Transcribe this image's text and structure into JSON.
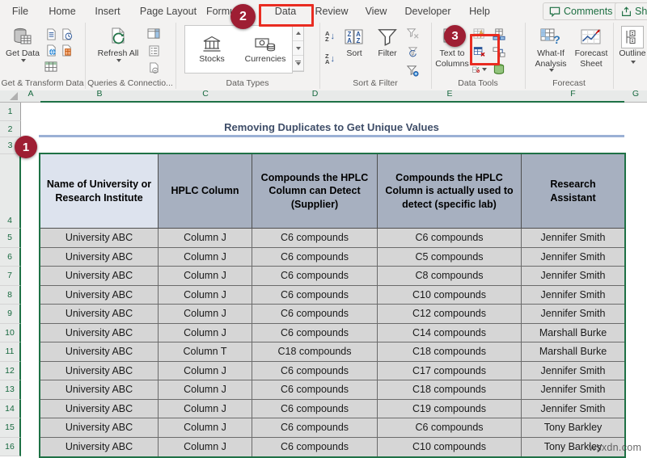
{
  "annotations": {
    "badge1": "1",
    "badge2": "2",
    "badge3": "3"
  },
  "ribbon": {
    "tabs": [
      "File",
      "Home",
      "Insert",
      "Page Layout",
      "Formulas",
      "Data",
      "Review",
      "View",
      "Developer",
      "Help"
    ],
    "comments_label": "Comments",
    "share_label": "Share",
    "groups": {
      "get_transform": {
        "label": "Get & Transform Data",
        "get_data": "Get Data"
      },
      "queries": {
        "label": "Queries & Connectio...",
        "refresh_all": "Refresh All"
      },
      "data_types": {
        "label": "Data Types",
        "stocks": "Stocks",
        "currencies": "Currencies"
      },
      "sort_filter": {
        "label": "Sort & Filter",
        "sort": "Sort",
        "filter": "Filter"
      },
      "data_tools": {
        "label": "Data Tools",
        "text_to_columns": "Text to Columns"
      },
      "forecast": {
        "label": "Forecast",
        "what_if": "What-If Analysis",
        "forecast_sheet": "Forecast Sheet"
      },
      "outline": {
        "outline": "Outline"
      }
    }
  },
  "sheet": {
    "column_letters": [
      "A",
      "B",
      "C",
      "D",
      "E",
      "F",
      "G"
    ],
    "row_numbers_top": [
      "1",
      "2",
      "3",
      "4"
    ],
    "title": "Removing Duplicates to Get Unique Values",
    "watermark": "wsxdn.com"
  },
  "table": {
    "headers": [
      "Name of University or Research Institute",
      "HPLC Column",
      "Compounds the HPLC Column can Detect (Supplier)",
      "Compounds the HPLC Column is actually used to detect (specific lab)",
      "Research Assistant"
    ],
    "rows": [
      {
        "num": "5",
        "cells": [
          "University ABC",
          "Column J",
          "C6 compounds",
          "C6 compounds",
          "Jennifer Smith"
        ]
      },
      {
        "num": "6",
        "cells": [
          "University ABC",
          "Column J",
          "C6 compounds",
          "C5 compounds",
          "Jennifer Smith"
        ]
      },
      {
        "num": "7",
        "cells": [
          "University ABC",
          "Column J",
          "C6 compounds",
          "C8 compounds",
          "Jennifer Smith"
        ]
      },
      {
        "num": "8",
        "cells": [
          "University ABC",
          "Column J",
          "C6 compounds",
          "C10 compounds",
          "Jennifer Smith"
        ]
      },
      {
        "num": "9",
        "cells": [
          "University ABC",
          "Column J",
          "C6 compounds",
          "C12 compounds",
          "Jennifer Smith"
        ]
      },
      {
        "num": "10",
        "cells": [
          "University ABC",
          "Column J",
          "C6 compounds",
          "C14 compounds",
          "Marshall Burke"
        ]
      },
      {
        "num": "11",
        "cells": [
          "University ABC",
          "Column T",
          "C18 compounds",
          "C18 compounds",
          "Marshall Burke"
        ]
      },
      {
        "num": "12",
        "cells": [
          "University ABC",
          "Column J",
          "C6 compounds",
          "C17 compounds",
          "Jennifer Smith"
        ]
      },
      {
        "num": "13",
        "cells": [
          "University ABC",
          "Column J",
          "C6 compounds",
          "C18 compounds",
          "Jennifer Smith"
        ]
      },
      {
        "num": "14",
        "cells": [
          "University ABC",
          "Column J",
          "C6 compounds",
          "C19 compounds",
          "Jennifer Smith"
        ]
      },
      {
        "num": "15",
        "cells": [
          "University ABC",
          "Column J",
          "C6 compounds",
          "C6 compounds",
          "Tony Barkley"
        ]
      },
      {
        "num": "16",
        "cells": [
          "University ABC",
          "Column J",
          "C6 compounds",
          "C10 compounds",
          "Tony Barkley"
        ]
      }
    ]
  }
}
